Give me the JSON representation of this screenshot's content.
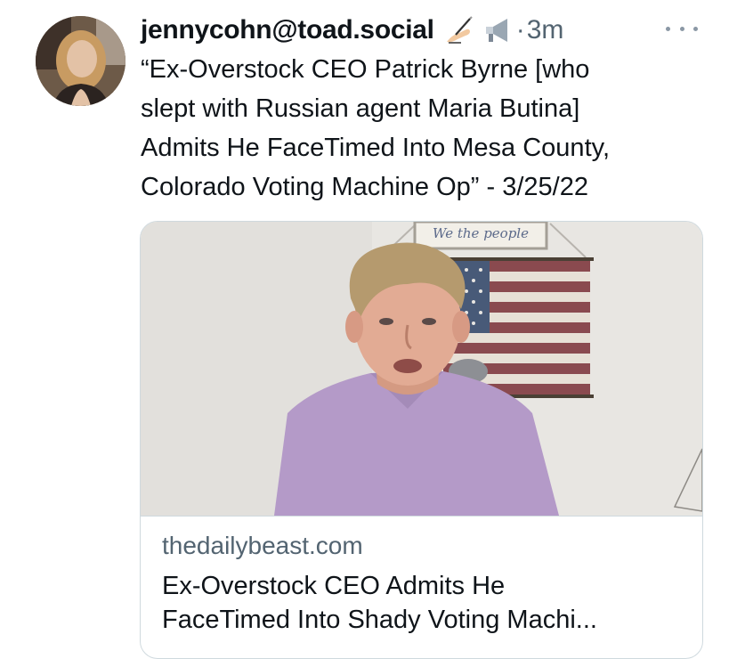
{
  "tweet": {
    "handle": "jennycohn@toad.social",
    "badges": [
      "writing-hand-emoji",
      "megaphone-emoji"
    ],
    "separator": "·",
    "time": "3m",
    "text": "“Ex-Overstock CEO Patrick Byrne [who\nslept with Russian agent Maria Butina]\nAdmits He FaceTimed Into Mesa County,\nColorado Voting Machine Op” - 3/25/22"
  },
  "card": {
    "image_sign_text": "We the people",
    "domain": "thedailybeast.com",
    "title": "Ex-Overstock CEO Admits He\nFaceTimed Into Shady Voting Machi..."
  },
  "colors": {
    "text": "#0f1419",
    "secondary": "#536471",
    "border": "#cfd9de",
    "shirt": "#b49ac8"
  }
}
